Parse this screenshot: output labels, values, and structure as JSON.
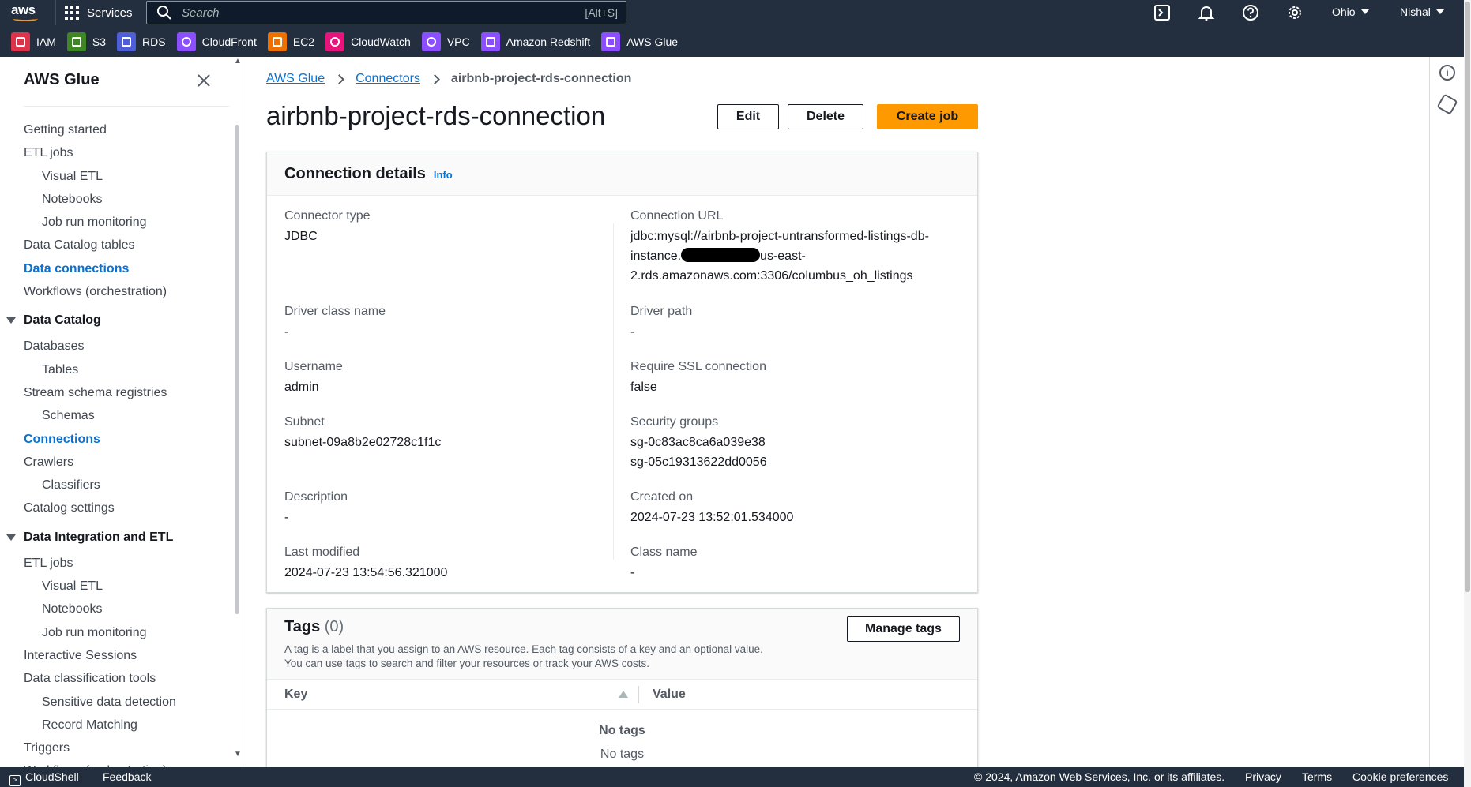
{
  "topnav": {
    "logo_text": "aws",
    "services_label": "Services",
    "search": {
      "placeholder": "Search",
      "shortcut": "[Alt+S]"
    },
    "region": "Ohio",
    "user": "Nishal",
    "favorites": [
      {
        "label": "IAM",
        "color": "#dd344c"
      },
      {
        "label": "S3",
        "color": "#3f8624"
      },
      {
        "label": "RDS",
        "color": "#4d5ed8"
      },
      {
        "label": "CloudFront",
        "color": "#8c4fff"
      },
      {
        "label": "EC2",
        "color": "#ed7100"
      },
      {
        "label": "CloudWatch",
        "color": "#e7157b"
      },
      {
        "label": "VPC",
        "color": "#8c4fff"
      },
      {
        "label": "Amazon Redshift",
        "color": "#8c4fff"
      },
      {
        "label": "AWS Glue",
        "color": "#8c4fff"
      }
    ]
  },
  "sidenav": {
    "title": "AWS Glue",
    "items": [
      {
        "label": "Getting started"
      },
      {
        "label": "ETL jobs"
      },
      {
        "label": "Visual ETL"
      },
      {
        "label": "Notebooks"
      },
      {
        "label": "Job run monitoring"
      },
      {
        "label": "Data Catalog tables"
      },
      {
        "label": "Data connections"
      },
      {
        "label": "Workflows (orchestration)"
      }
    ],
    "section_catalog": {
      "title": "Data Catalog",
      "items": [
        {
          "label": "Databases"
        },
        {
          "label": "Tables"
        },
        {
          "label": "Stream schema registries"
        },
        {
          "label": "Schemas"
        },
        {
          "label": "Connections"
        },
        {
          "label": "Crawlers"
        },
        {
          "label": "Classifiers"
        },
        {
          "label": "Catalog settings"
        }
      ]
    },
    "section_integration": {
      "title": "Data Integration and ETL",
      "items": [
        {
          "label": "ETL jobs"
        },
        {
          "label": "Visual ETL"
        },
        {
          "label": "Notebooks"
        },
        {
          "label": "Job run monitoring"
        },
        {
          "label": "Interactive Sessions"
        },
        {
          "label": "Data classification tools"
        },
        {
          "label": "Sensitive data detection"
        },
        {
          "label": "Record Matching"
        },
        {
          "label": "Triggers"
        },
        {
          "label": "Workflows (orchestration)"
        }
      ]
    }
  },
  "breadcrumb": {
    "root": "AWS Glue",
    "parent": "Connectors",
    "current": "airbnb-project-rds-connection"
  },
  "page": {
    "title": "airbnb-project-rds-connection",
    "edit_label": "Edit",
    "delete_label": "Delete",
    "create_job_label": "Create job"
  },
  "details": {
    "title": "Connection details",
    "info_label": "Info",
    "connector_type": {
      "label": "Connector type",
      "value": "JDBC"
    },
    "connection_url": {
      "label": "Connection URL",
      "line1": "jdbc:mysql://airbnb-project-untransformed-listings-db-",
      "line2_pre": "instance.",
      "line2_post": "us-east-",
      "line3": "2.rds.amazonaws.com:3306/columbus_oh_listings"
    },
    "driver_class": {
      "label": "Driver class name",
      "value": "-"
    },
    "driver_path": {
      "label": "Driver path",
      "value": "-"
    },
    "username": {
      "label": "Username",
      "value": "admin"
    },
    "require_ssl": {
      "label": "Require SSL connection",
      "value": "false"
    },
    "subnet": {
      "label": "Subnet",
      "value": "subnet-09a8b2e02728c1f1c"
    },
    "security_groups": {
      "label": "Security groups",
      "value1": "sg-0c83ac8ca6a039e38",
      "value2": "sg-05c19313622dd0056"
    },
    "description": {
      "label": "Description",
      "value": "-"
    },
    "created_on": {
      "label": "Created on",
      "value": "2024-07-23 13:52:01.534000"
    },
    "last_modified": {
      "label": "Last modified",
      "value": "2024-07-23 13:54:56.321000"
    },
    "class_name": {
      "label": "Class name",
      "value": "-"
    }
  },
  "tags": {
    "title": "Tags",
    "count": "(0)",
    "manage_label": "Manage tags",
    "desc1": "A tag is a label that you assign to an AWS resource. Each tag consists of a key and an optional value.",
    "desc2": "You can use tags to search and filter your resources or track your AWS costs.",
    "col_key": "Key",
    "col_value": "Value",
    "empty_title": "No tags",
    "empty_sub": "No tags"
  },
  "footer": {
    "cloudshell": "CloudShell",
    "feedback": "Feedback",
    "copyright": "© 2024, Amazon Web Services, Inc. or its affiliates.",
    "privacy": "Privacy",
    "terms": "Terms",
    "cookies": "Cookie preferences"
  }
}
